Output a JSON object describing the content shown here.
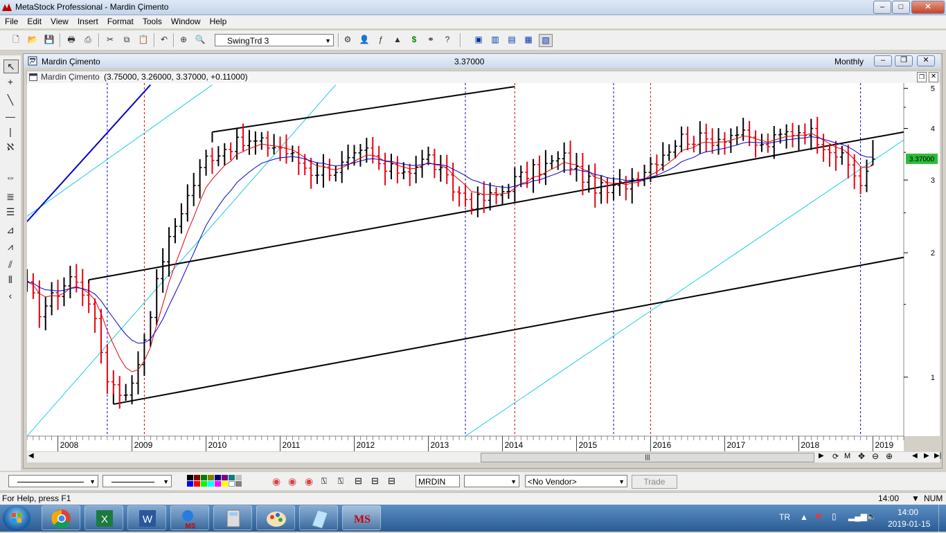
{
  "window": {
    "title": "MetaStock Professional - Mardin Çimento",
    "minimize": "–",
    "maximize": "□",
    "close": "✕"
  },
  "menu": [
    "File",
    "Edit",
    "View",
    "Insert",
    "Format",
    "Tools",
    "Window",
    "Help"
  ],
  "toolbar": {
    "template_select": "SwingTrd 3"
  },
  "chart_window": {
    "title": "Mardin Çimento",
    "last_price": "3.37000",
    "periodicity": "Monthly",
    "inner_title_name": "Mardin Çimento",
    "inner_title_values": "(3.75000, 3.26000, 3.37000, +0.11000)",
    "price_tag": "3.37000",
    "y_ticks": [
      "5",
      "4",
      "3",
      "2",
      "1"
    ],
    "x_labels": [
      "2008",
      "2009",
      "2010",
      "2011",
      "2012",
      "2013",
      "2014",
      "2015",
      "2016",
      "2017",
      "2018",
      "2019"
    ]
  },
  "chart_data": {
    "type": "bar",
    "series_type": "OHLC monthly price bars with moving averages and trend channels",
    "scale": "log",
    "ylim": [
      0.72,
      5.15
    ],
    "y_ticks": [
      5,
      4,
      3,
      2,
      1
    ],
    "x_range": [
      "2007-08",
      "2019-06"
    ],
    "colors": {
      "up": "#000000",
      "down": "#e8000e",
      "ma_short": "#e0000c",
      "ma_long": "#0000c8",
      "channel": "#000000",
      "fan": "#00c8d8",
      "cycle_blue": "#0000cc",
      "cycle_red": "#cc0000"
    },
    "anchors": [
      [
        "2007-08",
        1.65
      ],
      [
        "2007-10",
        1.45
      ],
      [
        "2007-12",
        1.55
      ],
      [
        "2008-03",
        1.75
      ],
      [
        "2008-06",
        1.55
      ],
      [
        "2008-09",
        1.0
      ],
      [
        "2008-11",
        0.92
      ],
      [
        "2009-01",
        0.95
      ],
      [
        "2009-03",
        1.25
      ],
      [
        "2009-06",
        1.95
      ],
      [
        "2009-09",
        2.55
      ],
      [
        "2010-01",
        3.4
      ],
      [
        "2010-05",
        3.65
      ],
      [
        "2010-09",
        3.7
      ],
      [
        "2011-01",
        3.6
      ],
      [
        "2011-06",
        3.15
      ],
      [
        "2011-10",
        3.2
      ],
      [
        "2012-03",
        3.5
      ],
      [
        "2012-06",
        3.15
      ],
      [
        "2012-10",
        3.2
      ],
      [
        "2013-01",
        3.4
      ],
      [
        "2013-05",
        2.85
      ],
      [
        "2013-08",
        2.65
      ],
      [
        "2013-12",
        2.75
      ],
      [
        "2014-03",
        3.0
      ],
      [
        "2014-07",
        3.2
      ],
      [
        "2014-11",
        3.4
      ],
      [
        "2015-03",
        2.95
      ],
      [
        "2015-06",
        2.8
      ],
      [
        "2015-09",
        2.95
      ],
      [
        "2015-12",
        3.2
      ],
      [
        "2016-03",
        3.5
      ],
      [
        "2016-06",
        3.8
      ],
      [
        "2016-10",
        3.75
      ],
      [
        "2017-03",
        3.9
      ],
      [
        "2017-07",
        3.6
      ],
      [
        "2017-11",
        3.9
      ],
      [
        "2018-02",
        4.0
      ],
      [
        "2018-06",
        3.6
      ],
      [
        "2018-09",
        3.25
      ],
      [
        "2018-11",
        2.95
      ],
      [
        "2019-01",
        3.37
      ]
    ],
    "last_bar": {
      "open": 3.26,
      "high": 3.75,
      "low": 3.26,
      "close": 3.37,
      "change": 0.11
    },
    "cycle_lines": [
      {
        "date": "2008-09",
        "color": "blue"
      },
      {
        "date": "2009-03",
        "color": "red"
      },
      {
        "date": "2013-07",
        "color": "blue"
      },
      {
        "date": "2014-03",
        "color": "red"
      },
      {
        "date": "2015-07",
        "color": "blue"
      },
      {
        "date": "2016-01",
        "color": "red"
      },
      {
        "date": "2018-11",
        "color": "blue"
      }
    ],
    "channel_lines": [
      {
        "from": [
          "2008-06",
          1.72
        ],
        "to": [
          "2019-06",
          3.92
        ]
      },
      {
        "from": [
          "2008-10",
          0.86
        ],
        "to": [
          "2019-06",
          1.95
        ]
      },
      {
        "from": [
          "2010-02",
          3.92
        ],
        "to": [
          "2014-03",
          5.05
        ]
      },
      {
        "from": [
          "2008-06",
          1.72
        ],
        "to": [
          "2008-06",
          1.72
        ]
      }
    ],
    "blue_trendline": {
      "from": [
        "2007-08",
        2.38
      ],
      "to": [
        "2009-04",
        5.1
      ]
    },
    "fan_lines": [
      {
        "from": [
          "2007-08",
          0.72
        ],
        "to": [
          "2011-10",
          5.1
        ]
      },
      {
        "from": [
          "2007-08",
          2.45
        ],
        "to": [
          "2010-02",
          5.1
        ]
      },
      {
        "from": [
          "2013-07",
          0.72
        ],
        "to": [
          "2019-06",
          3.75
        ]
      }
    ]
  },
  "bottom": {
    "symbol": "MRDIN",
    "vendor": "<No Vendor>",
    "trade": "Trade"
  },
  "status": {
    "help": "For Help, press F1",
    "time": "14:00",
    "num": "NUM"
  },
  "taskbar": {
    "lang": "TR",
    "time": "14:00",
    "date": "2019-01-15",
    "ms_label": "MS"
  }
}
